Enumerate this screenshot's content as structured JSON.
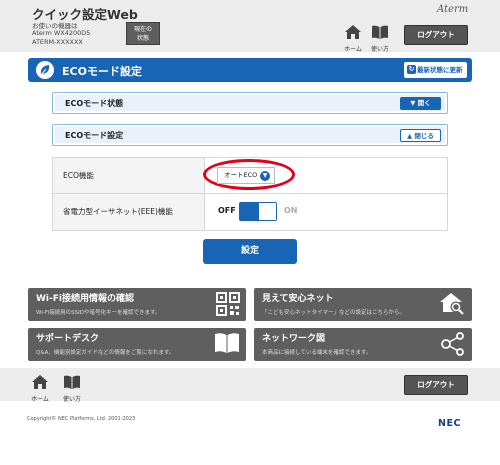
{
  "header": {
    "title": "クイック設定Web",
    "device_line1": "お使いの機器は",
    "device_line2": "Aterm WX4200D5",
    "device_line3": "ATERM-XXXXXX",
    "status_btn_line1": "現在の",
    "status_btn_line2": "状態",
    "brand": "Aterm",
    "home_label": "ホーム",
    "howto_label": "使い方",
    "logout_label": "ログアウト"
  },
  "page": {
    "title": "ECOモード設定",
    "refresh_label": "最新状態に更新"
  },
  "panels": {
    "status_title": "ECOモード状態",
    "status_btn": "開く",
    "settings_title": "ECOモード設定",
    "settings_btn": "閉じる"
  },
  "settings": {
    "eco_label": "ECO機能",
    "eco_value": "オートECO",
    "eee_label": "省電力型イーサネット(EEE)機能",
    "eee_off": "OFF",
    "eee_on": "ON",
    "eee_state": "OFF"
  },
  "save_label": "設定",
  "quicklinks": [
    {
      "title": "Wi-Fi接続用情報の確認",
      "desc": "Wi-Fi接続用のSSIDや暗号化キーを確認できます。",
      "icon": "qr-code-icon"
    },
    {
      "title": "見えて安心ネット",
      "desc": "「こども安心ネットタイマー」などの設定はこちらから。",
      "icon": "home-search-icon"
    },
    {
      "title": "サポートデスク",
      "desc": "Q&A、機能別設定ガイドなどの情報をご覧になれます。",
      "icon": "book-icon"
    },
    {
      "title": "ネットワーク図",
      "desc": "本商品に接続している端末を確認できます。",
      "icon": "network-icon"
    }
  ],
  "footer": {
    "home_label": "ホーム",
    "howto_label": "使い方",
    "logout_label": "ログアウト",
    "copyright": "Copyright© NEC Platforms, Ltd. 2001-2023",
    "nec_logo": "NEC"
  },
  "colors": {
    "primary": "#1864b5",
    "highlight_ring": "#e1001b",
    "dark_button": "#5f5f5f"
  }
}
